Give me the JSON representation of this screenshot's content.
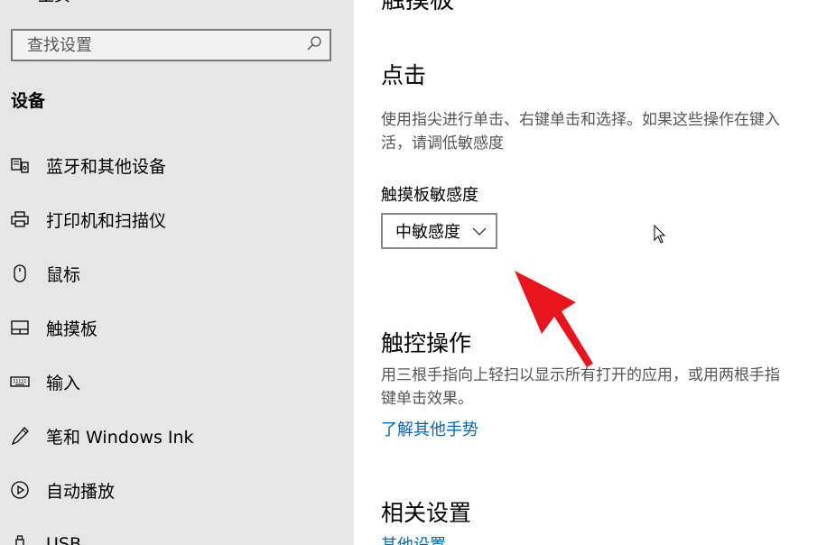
{
  "sidebar": {
    "home_label": "主页",
    "search_placeholder": "查找设置",
    "section_title": "设备",
    "items": [
      {
        "label": "蓝牙和其他设备",
        "icon": "bluetooth-devices-icon"
      },
      {
        "label": "打印机和扫描仪",
        "icon": "printer-icon"
      },
      {
        "label": "鼠标",
        "icon": "mouse-icon"
      },
      {
        "label": "触摸板",
        "icon": "touchpad-icon"
      },
      {
        "label": "输入",
        "icon": "keyboard-icon"
      },
      {
        "label": "笔和 Windows Ink",
        "icon": "pen-icon"
      },
      {
        "label": "自动播放",
        "icon": "autoplay-icon"
      },
      {
        "label": "USB",
        "icon": "usb-icon"
      }
    ]
  },
  "main": {
    "page_title": "触摸板",
    "tap": {
      "heading": "点击",
      "desc_line1": "使用指尖进行单击、右键单击和选择。如果这些操作在键入",
      "desc_line2": "活，请调低敏感度",
      "sensitivity_label": "触摸板敏感度",
      "sensitivity_value": "中敏感度"
    },
    "gestures": {
      "heading": "触控操作",
      "desc_line1": "用三根手指向上轻扫以显示所有打开的应用，或用两根手指",
      "desc_line2": "键单击效果。",
      "link": "了解其他手势"
    },
    "related": {
      "heading": "相关设置",
      "link": "其他设置"
    }
  },
  "colors": {
    "sidebar_bg": "#e6e6e6",
    "link": "#0067b8",
    "annotation_arrow": "#e8141e"
  }
}
